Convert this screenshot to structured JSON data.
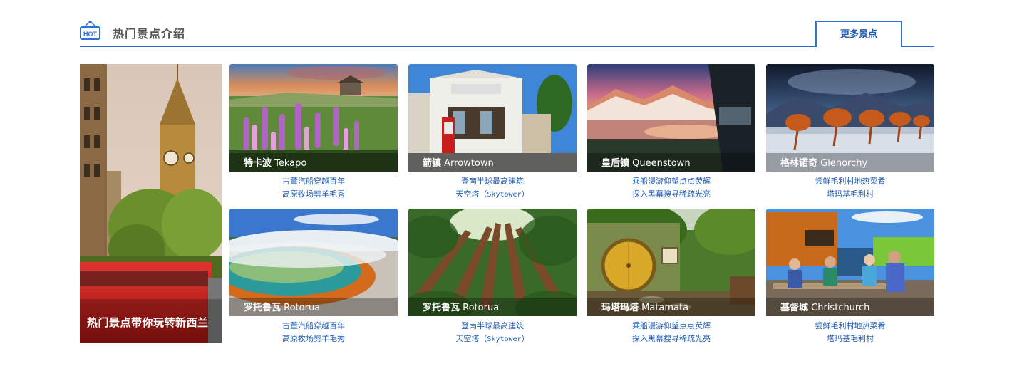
{
  "section": {
    "hot_badge": "HOT",
    "title": "热门景点介绍",
    "more_label": "更多景点"
  },
  "feature": {
    "caption": "热门景点带你玩转新西兰"
  },
  "cards": [
    {
      "name_cn": "特卡波",
      "name_en": "Tekapo",
      "line1": "古董汽船穿越百年",
      "line2": "高原牧场剪羊毛秀",
      "line2_extra": ""
    },
    {
      "name_cn": "箭镇",
      "name_en": "Arrowtown",
      "line1": "登南半球最高建筑",
      "line2": "天空塔（",
      "line2_extra": "Skytower",
      "line2_end": "）"
    },
    {
      "name_cn": "皇后镇",
      "name_en": "Queenstown",
      "line1": "乘船漫游仰望点点荧辉",
      "line2": "探入黑幕搜寻稀疏光亮",
      "line2_extra": ""
    },
    {
      "name_cn": "格林诺奇",
      "name_en": "Glenorchy",
      "line1": "尝鲜毛利村地热菜肴",
      "line2": "塔玛基毛利村",
      "line2_extra": ""
    },
    {
      "name_cn": "罗托鲁瓦",
      "name_en": "Rotorua",
      "line1": "古董汽船穿越百年",
      "line2": "高原牧场剪羊毛秀",
      "line2_extra": ""
    },
    {
      "name_cn": "罗托鲁瓦",
      "name_en": "Rotorua",
      "line1": "登南半球最高建筑",
      "line2": "天空塔（",
      "line2_extra": "Skytower",
      "line2_end": "）"
    },
    {
      "name_cn": "玛塔玛塔",
      "name_en": "Matamata",
      "line1": "乘船漫游仰望点点荧辉",
      "line2": "探入黑幕搜寻稀疏光亮",
      "line2_extra": ""
    },
    {
      "name_cn": "基督城",
      "name_en": "Christchurch",
      "line1": "尝鲜毛利村地热菜肴",
      "line2": "塔玛基毛利村",
      "line2_extra": ""
    }
  ],
  "colors": {
    "accent": "#2a72d6",
    "link": "#1f5bb5",
    "title": "#555555"
  }
}
